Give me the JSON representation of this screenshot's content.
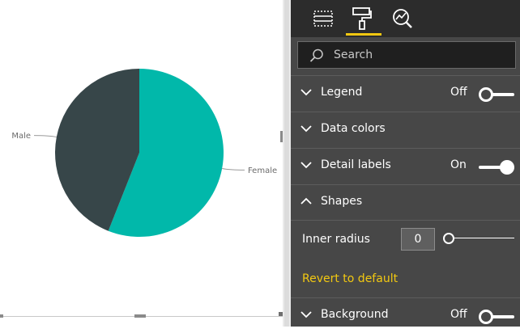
{
  "canvas": {
    "chart_data": {
      "type": "pie",
      "categories": [
        "Male",
        "Female"
      ],
      "values": [
        44,
        56
      ],
      "colors": [
        "#374649",
        "#01b8aa"
      ],
      "title": "",
      "legend": "off"
    }
  },
  "pane": {
    "tabs": [
      {
        "name": "Fields",
        "icon": "fields-icon"
      },
      {
        "name": "Format",
        "icon": "paint-roller-icon",
        "active": true
      },
      {
        "name": "Analytics",
        "icon": "analytics-icon"
      }
    ],
    "search_placeholder": "Search",
    "sections": {
      "legend": {
        "title": "Legend",
        "state": "Off"
      },
      "data_colors": {
        "title": "Data colors"
      },
      "detail_labels": {
        "title": "Detail labels",
        "state": "On"
      },
      "shapes": {
        "title": "Shapes"
      },
      "background": {
        "title": "Background",
        "state": "Off"
      }
    },
    "shapes": {
      "inner_radius_label": "Inner radius",
      "inner_radius_value": "0",
      "revert_label": "Revert to default"
    },
    "accent_color": "#f2c811"
  }
}
